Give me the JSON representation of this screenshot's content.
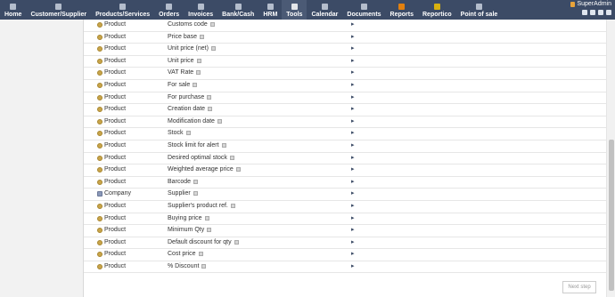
{
  "nav": [
    {
      "label": "Home",
      "icon": "home-icon"
    },
    {
      "label": "Customer/Supplier",
      "icon": "company-icon"
    },
    {
      "label": "Products/Services",
      "icon": "product-icon"
    },
    {
      "label": "Orders",
      "icon": "orders-icon"
    },
    {
      "label": "Invoices",
      "icon": "invoice-icon"
    },
    {
      "label": "Bank/Cash",
      "icon": "bank-icon"
    },
    {
      "label": "HRM",
      "icon": "hrm-icon"
    },
    {
      "label": "Tools",
      "icon": "tools-icon",
      "active": true
    },
    {
      "label": "Calendar",
      "icon": "calendar-icon"
    },
    {
      "label": "Documents",
      "icon": "documents-icon"
    },
    {
      "label": "Reports",
      "icon": "reports-icon"
    },
    {
      "label": "Reportico",
      "icon": "reportico-icon"
    },
    {
      "label": "Point of sale",
      "icon": "pos-icon"
    }
  ],
  "user": {
    "name": "SuperAdmin"
  },
  "rows": [
    {
      "entity": "Product",
      "field": "Customs code"
    },
    {
      "entity": "Product",
      "field": "Price base"
    },
    {
      "entity": "Product",
      "field": "Unit price (net)"
    },
    {
      "entity": "Product",
      "field": "Unit price"
    },
    {
      "entity": "Product",
      "field": "VAT Rate"
    },
    {
      "entity": "Product",
      "field": "For sale"
    },
    {
      "entity": "Product",
      "field": "For purchase"
    },
    {
      "entity": "Product",
      "field": "Creation date"
    },
    {
      "entity": "Product",
      "field": "Modification date"
    },
    {
      "entity": "Product",
      "field": "Stock"
    },
    {
      "entity": "Product",
      "field": "Stock limit for alert"
    },
    {
      "entity": "Product",
      "field": "Desired optimal stock"
    },
    {
      "entity": "Product",
      "field": "Weighted average price"
    },
    {
      "entity": "Product",
      "field": "Barcode"
    },
    {
      "entity": "Company",
      "field": "Supplier"
    },
    {
      "entity": "Product",
      "field": "Supplier's product ref."
    },
    {
      "entity": "Product",
      "field": "Buying price"
    },
    {
      "entity": "Product",
      "field": "Minimum Qty"
    },
    {
      "entity": "Product",
      "field": "Default discount for qty"
    },
    {
      "entity": "Product",
      "field": "Cost price"
    },
    {
      "entity": "Product",
      "field": "% Discount"
    }
  ],
  "next_step_label": "Next step"
}
